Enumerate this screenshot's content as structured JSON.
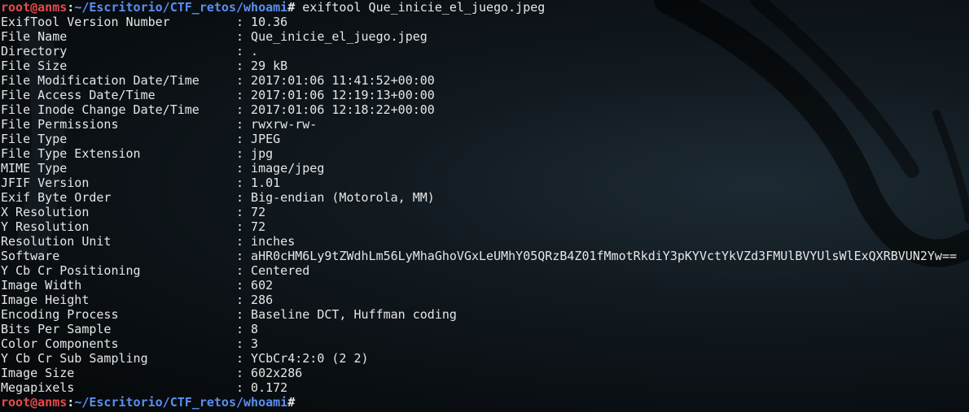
{
  "prompt": {
    "user": "root@anms",
    "separator": ":",
    "path": "~/Escritorio/CTF_retos/whoami",
    "symbol": "#",
    "command": " exiftool Que_inicie_el_juego.jpeg"
  },
  "exif": [
    {
      "key": "ExifTool Version Number",
      "value": ": 10.36"
    },
    {
      "key": "File Name",
      "value": ": Que_inicie_el_juego.jpeg"
    },
    {
      "key": "Directory",
      "value": ": ."
    },
    {
      "key": "File Size",
      "value": ": 29 kB"
    },
    {
      "key": "File Modification Date/Time",
      "value": ": 2017:01:06 11:41:52+00:00"
    },
    {
      "key": "File Access Date/Time",
      "value": ": 2017:01:06 12:19:13+00:00"
    },
    {
      "key": "File Inode Change Date/Time",
      "value": ": 2017:01:06 12:18:22+00:00"
    },
    {
      "key": "File Permissions",
      "value": ": rwxrw-rw-"
    },
    {
      "key": "File Type",
      "value": ": JPEG"
    },
    {
      "key": "File Type Extension",
      "value": ": jpg"
    },
    {
      "key": "MIME Type",
      "value": ": image/jpeg"
    },
    {
      "key": "JFIF Version",
      "value": ": 1.01"
    },
    {
      "key": "Exif Byte Order",
      "value": ": Big-endian (Motorola, MM)"
    },
    {
      "key": "X Resolution",
      "value": ": 72"
    },
    {
      "key": "Y Resolution",
      "value": ": 72"
    },
    {
      "key": "Resolution Unit",
      "value": ": inches"
    },
    {
      "key": "Software",
      "value": ": aHR0cHM6Ly9tZWdhLm56LyMhaGhoVGxLeUMhY05QRzB4Z01fMmotRkdiY3pKYVctYkVZd3FMUlBVYUlsWlExQXRBVUN2Yw=="
    },
    {
      "key": "Y Cb Cr Positioning",
      "value": ": Centered"
    },
    {
      "key": "Image Width",
      "value": ": 602"
    },
    {
      "key": "Image Height",
      "value": ": 286"
    },
    {
      "key": "Encoding Process",
      "value": ": Baseline DCT, Huffman coding"
    },
    {
      "key": "Bits Per Sample",
      "value": ": 8"
    },
    {
      "key": "Color Components",
      "value": ": 3"
    },
    {
      "key": "Y Cb Cr Sub Sampling",
      "value": ": YCbCr4:2:0 (2 2)"
    },
    {
      "key": "Image Size",
      "value": ": 602x286"
    },
    {
      "key": "Megapixels",
      "value": ": 0.172"
    }
  ],
  "prompt2": {
    "user": "root@anms",
    "separator": ":",
    "path": "~/Escritorio/CTF_retos/whoami",
    "symbol": "#"
  },
  "colors": {
    "prompt_user": "#e84a4a",
    "prompt_path": "#5a8ff0",
    "text": "#e6e6e6",
    "background": "#0a0f13"
  },
  "icons": {
    "wallpaper": "kali-dragon-swoosh"
  }
}
